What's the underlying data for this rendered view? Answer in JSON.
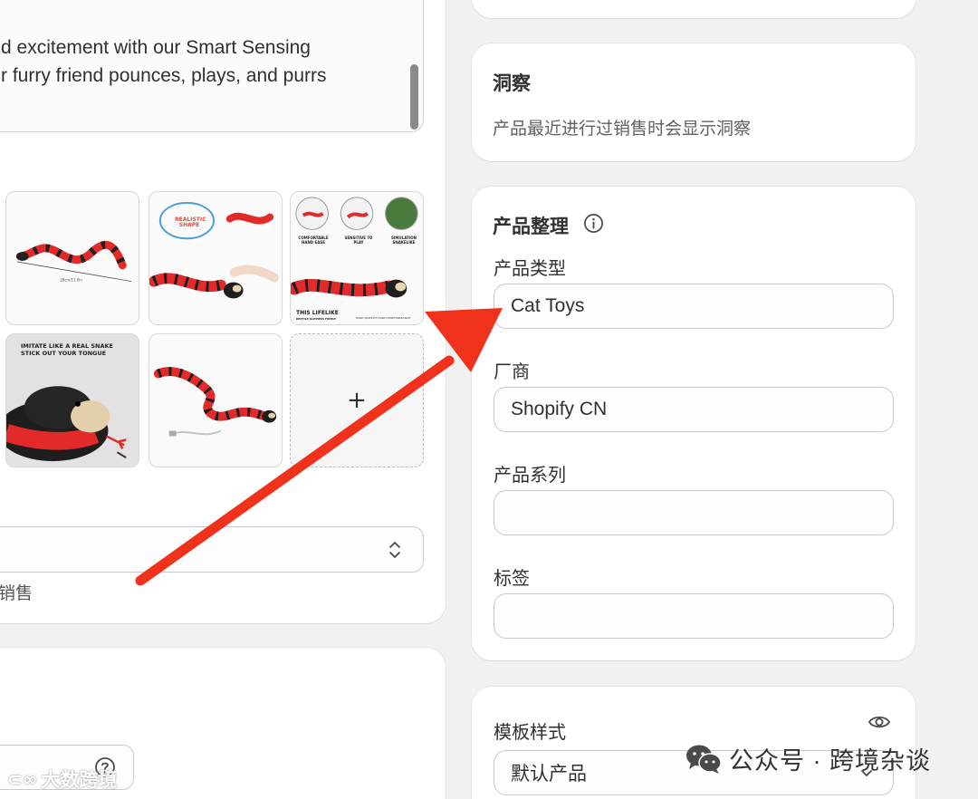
{
  "left": {
    "description_lines": [
      "d excitement with our Smart Sensing",
      "r furry friend pounces, plays, and purrs"
    ],
    "media_captions": {
      "realistic": "REALISTIC SHAPE",
      "comfortable": "COMFORTABLE HAND EASE",
      "sensitive": "SENSITIVE TO PLAY",
      "simulation": "SIMULATION SNAKELIKE",
      "lifelike_title": "THIS LIFELIKE",
      "lifelike_sub": "REPTILE SLITHERS FREELY",
      "quality": "HIGH QUALITY HIGH PERFORMANCE",
      "imitate_1": "IMITATE LIKE A REAL SNAKE",
      "imitate_2": "STICK OUT YOUR TONGUE"
    },
    "add_media_label": "+",
    "select_hint": "销售"
  },
  "insights": {
    "title": "洞察",
    "text": "产品最近进行过销售时会显示洞察"
  },
  "organization": {
    "title": "产品整理",
    "info_icon": "info-icon",
    "product_type_label": "产品类型",
    "product_type_value": "Cat Toys",
    "vendor_label": "厂商",
    "vendor_value": "Shopify CN",
    "collections_label": "产品系列",
    "collections_value": "",
    "tags_label": "标签",
    "tags_value": ""
  },
  "template": {
    "label": "模板样式",
    "value": "默认产品"
  },
  "watermarks": {
    "left": "大数跨境",
    "right": "公众号 · 跨境杂谈"
  },
  "colors": {
    "arrow": "#f0311b",
    "snake_red": "#e32a2a"
  }
}
